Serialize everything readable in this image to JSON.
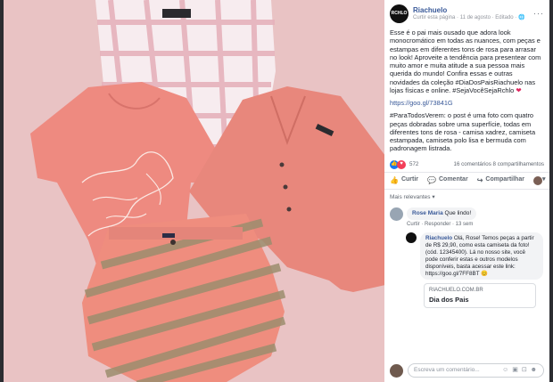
{
  "colors": {
    "panel_bg": "#ffffff",
    "link": "#385898",
    "backdrop": "#e7bfbf"
  },
  "post": {
    "page_avatar_text": "RCHLO",
    "page_name": "Riachuelo",
    "subline": "Curtir esta página · 11 de agosto · Editado · ",
    "more": "···",
    "paragraphs": [
      "Esse é o pai mais ousado que adora look monocromático em todas as nuances, com peças e estampas em diferentes tons de rosa para arrasar no look! Aproveite a tendência para presentear com muito amor e muita atitude a sua pessoa mais querida do mundo! Confira essas e outras novidades da coleção #DiaDosPaisRiachuelo nas lojas físicas e online. #SejaVocêSejaRchlo",
      "https://goo.gl/73841G",
      "#ParaTodosVerem: o post é uma foto com quatro peças dobradas sobre uma superfície, todas em diferentes tons de rosa - camisa xadrez, camiseta estampada, camiseta polo lisa e bermuda com padronagem listrada."
    ]
  },
  "reactions": {
    "count": "572",
    "meta": "16 comentários  8 compartilhamentos"
  },
  "actions": [
    "Curtir",
    "Comentar",
    "Compartilhar"
  ],
  "filter_label": "Mais relevantes ▾",
  "comment": {
    "author": "Rose Maria",
    "text": "Que lindo!",
    "links": "Curtir · Responder · 13 sem"
  },
  "reply": {
    "author": "Riachuelo",
    "text": "Olá, Rose! Temos peças a partir de R$ 29,90, como esta camiseta da foto! (cód. 12345400). Lá no nosso site, você pode conferir estas e outros modelos disponíveis, basta acessar este link: https://goo.gl/7FF8BT 😊"
  },
  "preview": {
    "domain": "riachuelo.com.br",
    "title": "Dia dos Pais"
  },
  "composer": {
    "placeholder": "Escreva um comentário...",
    "icons": "☺ ▣ ⊡ ☻"
  }
}
